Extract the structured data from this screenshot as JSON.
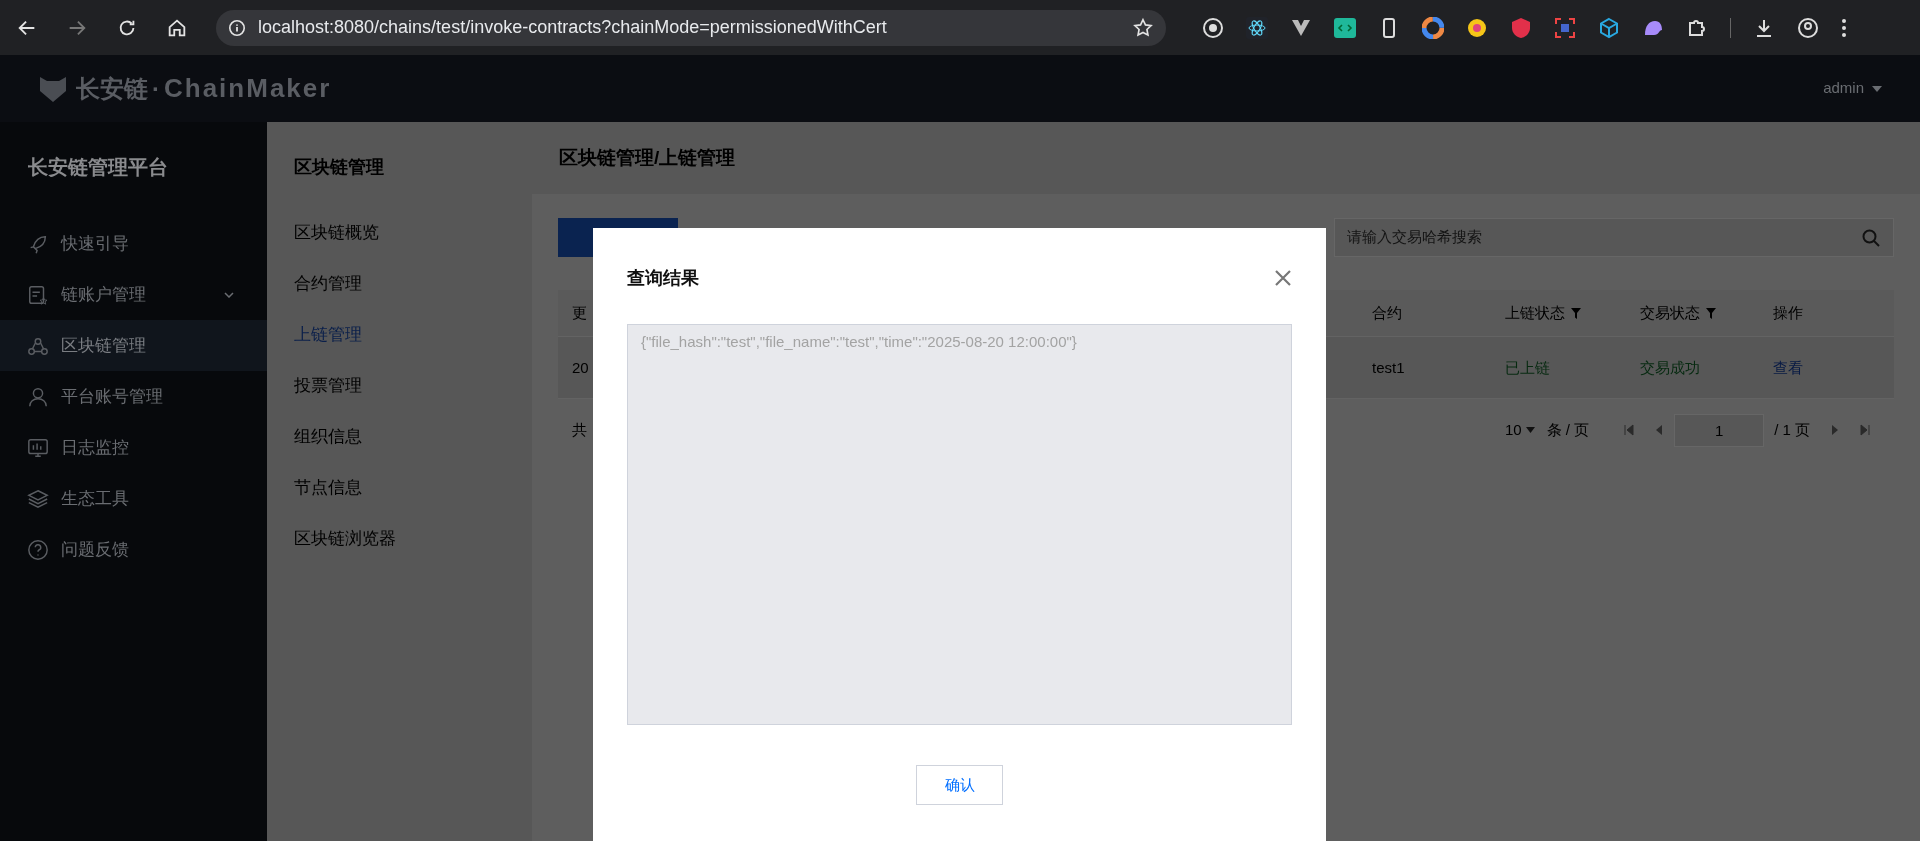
{
  "browser": {
    "url": "localhost:8080/chains/test/invoke-contracts?chainMode=permissionedWithCert",
    "forward_disabled": true
  },
  "header": {
    "logo_cn": "长安链",
    "logo_dot": "·",
    "logo_en": "ChainMaker",
    "user": "admin"
  },
  "sidebar": {
    "title": "长安链管理平台",
    "items": [
      {
        "label": "快速引导",
        "expandable": false,
        "selected": false
      },
      {
        "label": "链账户管理",
        "expandable": true,
        "selected": false
      },
      {
        "label": "区块链管理",
        "expandable": false,
        "selected": true
      },
      {
        "label": "平台账号管理",
        "expandable": false,
        "selected": false
      },
      {
        "label": "日志监控",
        "expandable": false,
        "selected": false
      },
      {
        "label": "生态工具",
        "expandable": false,
        "selected": false
      },
      {
        "label": "问题反馈",
        "expandable": false,
        "selected": false
      }
    ]
  },
  "subnav": {
    "title": "区块链管理",
    "items": [
      {
        "label": "区块链概览",
        "selected": false
      },
      {
        "label": "合约管理",
        "selected": false
      },
      {
        "label": "上链管理",
        "selected": true
      },
      {
        "label": "投票管理",
        "selected": false
      },
      {
        "label": "组织信息",
        "selected": false
      },
      {
        "label": "节点信息",
        "selected": false
      },
      {
        "label": "区块链浏览器",
        "selected": false
      }
    ]
  },
  "content": {
    "breadcrumb": "区块链管理/上链管理",
    "search": {
      "placeholder": "请输入交易哈希搜索"
    },
    "table": {
      "columns": [
        {
          "label": "更",
          "filter": false
        },
        {
          "label": "合约",
          "filter": false
        },
        {
          "label": "上链状态",
          "filter": true
        },
        {
          "label": "交易状态",
          "filter": true
        },
        {
          "label": "操作",
          "filter": false
        }
      ],
      "rows": [
        {
          "cells": [
            {
              "text": "20",
              "kind": "plain"
            },
            {
              "text": "test1",
              "kind": "plain"
            },
            {
              "text": "已上链",
              "kind": "success"
            },
            {
              "text": "交易成功",
              "kind": "success"
            },
            {
              "text": "查看",
              "kind": "link"
            }
          ]
        }
      ]
    },
    "pagination": {
      "total_prefix": "共",
      "page_size": "10",
      "page_size_unit": "条 / 页",
      "page": "1",
      "page_total": "/ 1 页"
    }
  },
  "modal": {
    "title": "查询结果",
    "result": "{\"file_hash\":\"test\",\"file_name\":\"test\",\"time\":\"2025-08-20 12:00:00\"}",
    "confirm": "确认"
  }
}
